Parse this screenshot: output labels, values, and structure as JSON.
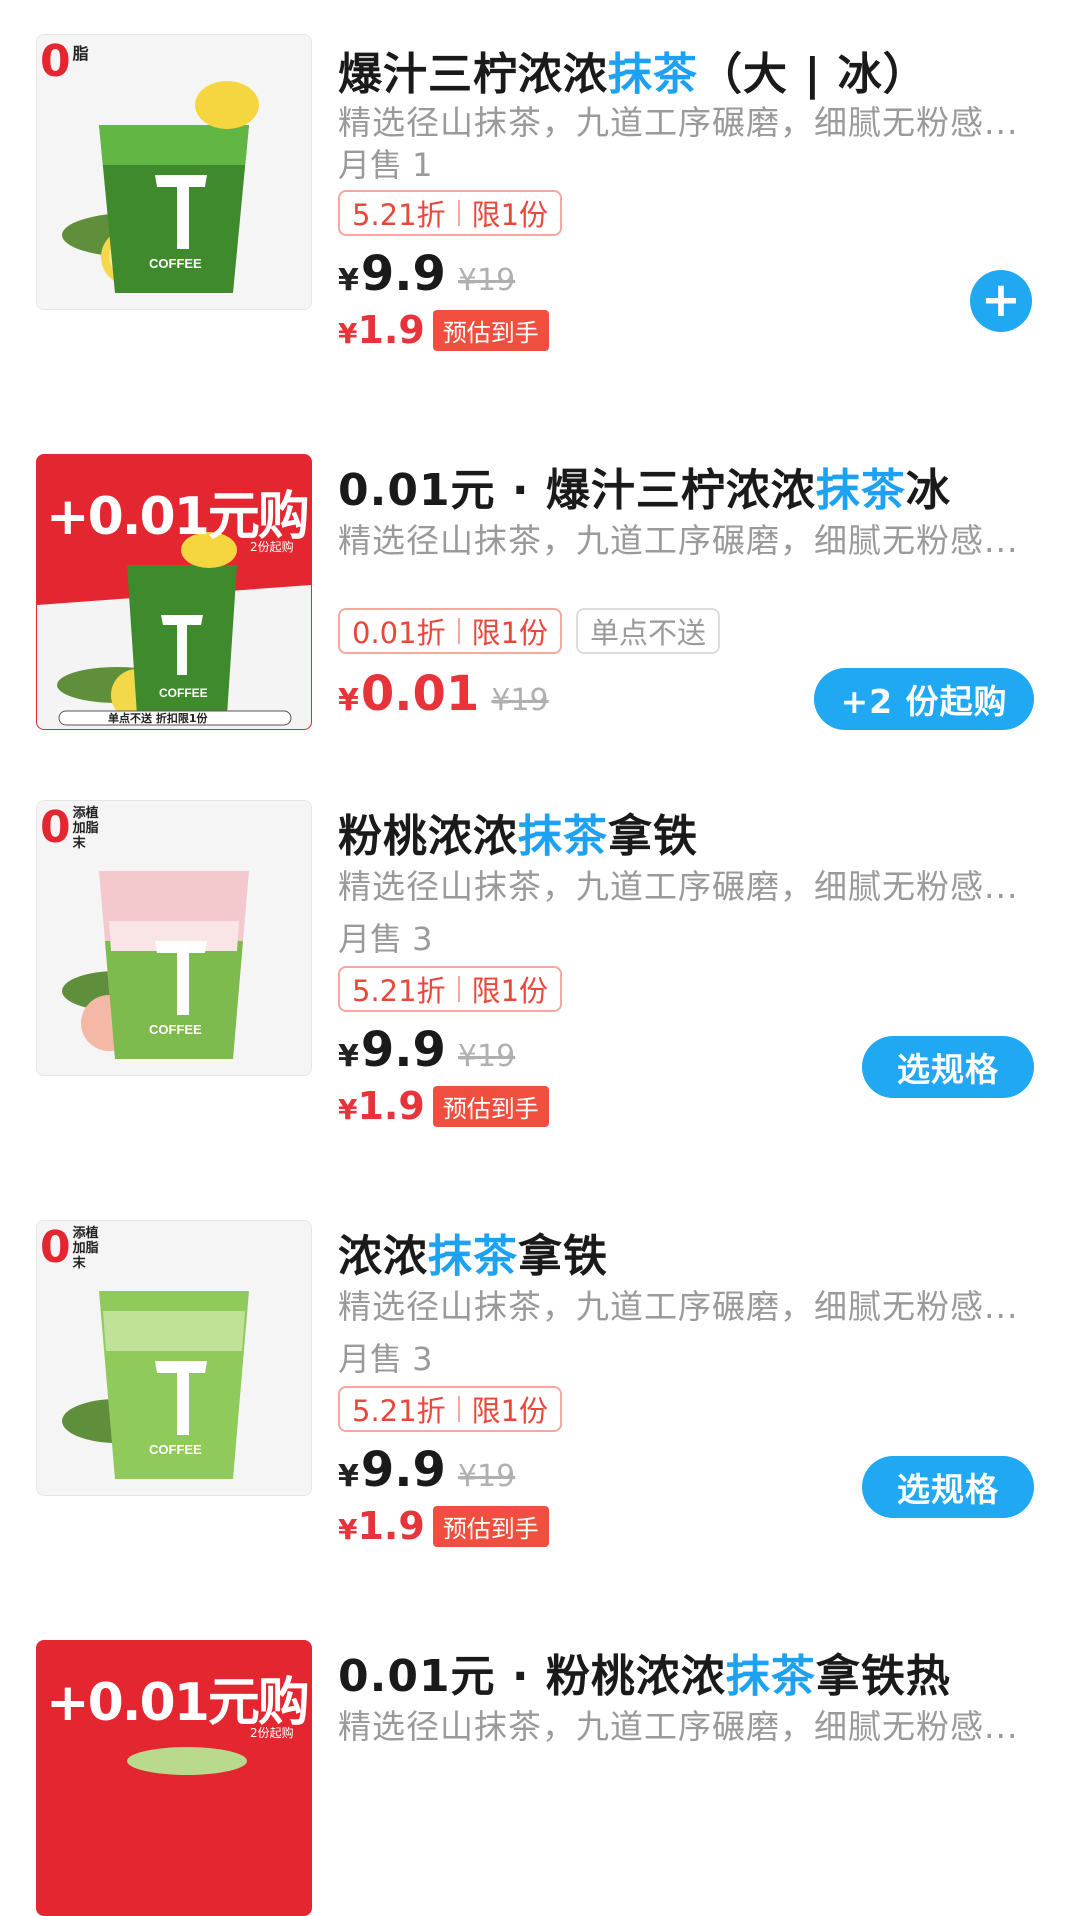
{
  "colors": {
    "accent": "#20a9f2",
    "highlight": "#1da1f2",
    "price_red": "#e8333b",
    "promo_red": "#e3262f"
  },
  "items": [
    {
      "title_pre": "爆汁三柠浓浓",
      "title_hl": "抹茶",
      "title_post": "（大 | 冰）",
      "desc": "精选径山抹茶，九道工序碾磨，细腻无粉感...",
      "sales": "月售 1",
      "discount": "5.21折",
      "limit": "限1份",
      "yen": "¥",
      "price": "9.9",
      "orig": "¥19",
      "final_yen": "¥",
      "final": "1.9",
      "est_label": "预估到手",
      "action_icon": "plus-icon",
      "action": "+",
      "thumb_badge": "0",
      "thumb_badge_text": "脂",
      "thumb_brand": "COFFEE"
    },
    {
      "title_pre": "0.01元 · 爆汁三柠浓浓",
      "title_hl": "抹茶",
      "title_post": "冰",
      "desc": "精选径山抹茶，九道工序碾磨，细腻无粉感...",
      "discount": "0.01折",
      "limit": "限1份",
      "extra_tag": "单点不送",
      "yen": "¥",
      "price": "0.01",
      "orig": "¥19",
      "action": "+2 份起购",
      "promo_text": "+0.01元购",
      "promo_sub": "2份起购",
      "promo_bottom": "单点不送 折扣限1份",
      "thumb_brand": "COFFEE"
    },
    {
      "title_pre": "粉桃浓浓",
      "title_hl": "抹茶",
      "title_post": "拿铁",
      "desc": "精选径山抹茶，九道工序碾磨，细腻无粉感...",
      "sales": "月售 3",
      "discount": "5.21折",
      "limit": "限1份",
      "yen": "¥",
      "price": "9.9",
      "orig": "¥19",
      "final_yen": "¥",
      "final": "1.9",
      "est_label": "预估到手",
      "action": "选规格",
      "thumb_badge": "0",
      "thumb_badge_text": "添植加脂末",
      "thumb_brand": "COFFEE"
    },
    {
      "title_pre": "浓浓",
      "title_hl": "抹茶",
      "title_post": "拿铁",
      "desc": "精选径山抹茶，九道工序碾磨，细腻无粉感...",
      "sales": "月售 3",
      "discount": "5.21折",
      "limit": "限1份",
      "yen": "¥",
      "price": "9.9",
      "orig": "¥19",
      "final_yen": "¥",
      "final": "1.9",
      "est_label": "预估到手",
      "action": "选规格",
      "thumb_badge": "0",
      "thumb_badge_text": "添植加脂末",
      "thumb_brand": "COFFEE"
    },
    {
      "title_pre": "0.01元 · 粉桃浓浓",
      "title_hl": "抹茶",
      "title_post": "拿铁热",
      "desc": "精选径山抹茶，九道工序碾磨，细腻无粉感...",
      "promo_text": "+0.01元购",
      "promo_sub": "2份起购"
    }
  ]
}
